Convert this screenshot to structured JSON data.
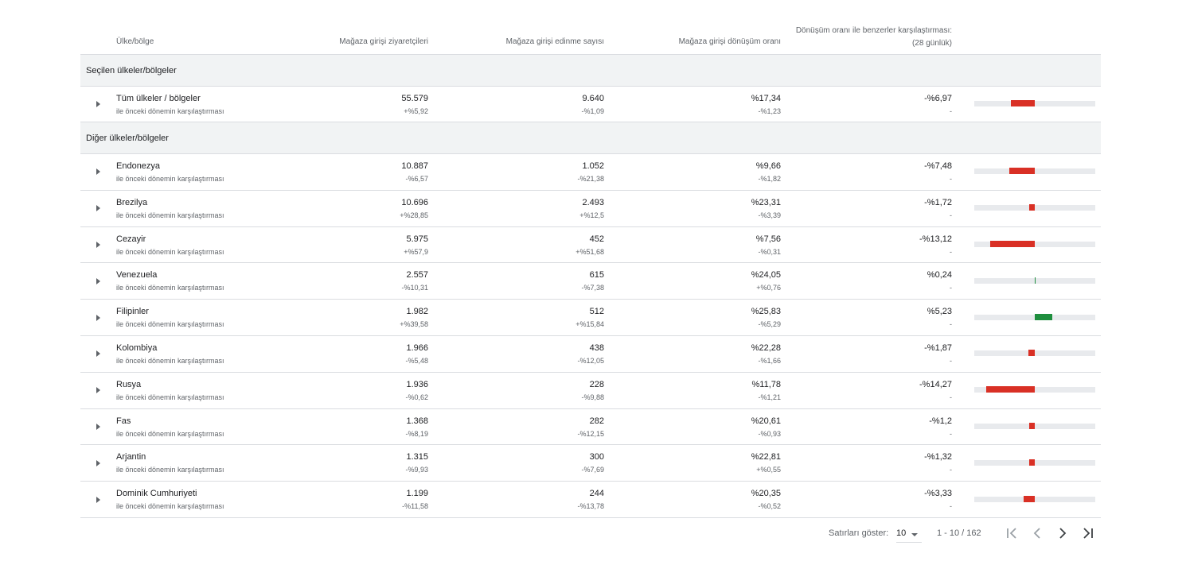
{
  "header": {
    "country": "Ülke/bölge",
    "visitors": "Mağaza girişi ziyaretçileri",
    "acquisitions": "Mağaza girişi edinme sayısı",
    "conversion": "Mağaza girişi dönüşüm oranı",
    "benchmark_line1": "Dönüşüm oranı ile benzerler karşılaştırması:",
    "benchmark_line2": "(28 günlük)"
  },
  "sections": {
    "selected": "Seçilen ülkeler/bölgeler",
    "other": "Diğer ülkeler/bölgeler"
  },
  "comparison_label": "ile önceki dönemin karşılaştırması",
  "all_row": {
    "name": "Tüm ülkeler / bölgeler",
    "visitors": "55.579",
    "visitors_change": "+%5,92",
    "acquisitions": "9.640",
    "acquisitions_change": "-%1,09",
    "conversion": "%17,34",
    "conversion_change": "-%1,23",
    "benchmark": "-%6,97",
    "benchmark_sub": "-",
    "benchmark_value": -6.97
  },
  "rows": [
    {
      "name": "Endonezya",
      "visitors": "10.887",
      "visitors_change": "-%6,57",
      "acquisitions": "1.052",
      "acquisitions_change": "-%21,38",
      "conversion": "%9,66",
      "conversion_change": "-%1,82",
      "benchmark": "-%7,48",
      "benchmark_sub": "-",
      "benchmark_value": -7.48
    },
    {
      "name": "Brezilya",
      "visitors": "10.696",
      "visitors_change": "+%28,85",
      "acquisitions": "2.493",
      "acquisitions_change": "+%12,5",
      "conversion": "%23,31",
      "conversion_change": "-%3,39",
      "benchmark": "-%1,72",
      "benchmark_sub": "-",
      "benchmark_value": -1.72
    },
    {
      "name": "Cezayir",
      "visitors": "5.975",
      "visitors_change": "+%57,9",
      "acquisitions": "452",
      "acquisitions_change": "+%51,68",
      "conversion": "%7,56",
      "conversion_change": "-%0,31",
      "benchmark": "-%13,12",
      "benchmark_sub": "-",
      "benchmark_value": -13.12
    },
    {
      "name": "Venezuela",
      "visitors": "2.557",
      "visitors_change": "-%10,31",
      "acquisitions": "615",
      "acquisitions_change": "-%7,38",
      "conversion": "%24,05",
      "conversion_change": "+%0,76",
      "benchmark": "%0,24",
      "benchmark_sub": "-",
      "benchmark_value": 0.24
    },
    {
      "name": "Filipinler",
      "visitors": "1.982",
      "visitors_change": "+%39,58",
      "acquisitions": "512",
      "acquisitions_change": "+%15,84",
      "conversion": "%25,83",
      "conversion_change": "-%5,29",
      "benchmark": "%5,23",
      "benchmark_sub": "-",
      "benchmark_value": 5.23
    },
    {
      "name": "Kolombiya",
      "visitors": "1.966",
      "visitors_change": "-%5,48",
      "acquisitions": "438",
      "acquisitions_change": "-%12,05",
      "conversion": "%22,28",
      "conversion_change": "-%1,66",
      "benchmark": "-%1,87",
      "benchmark_sub": "-",
      "benchmark_value": -1.87
    },
    {
      "name": "Rusya",
      "visitors": "1.936",
      "visitors_change": "-%0,62",
      "acquisitions": "228",
      "acquisitions_change": "-%9,88",
      "conversion": "%11,78",
      "conversion_change": "-%1,21",
      "benchmark": "-%14,27",
      "benchmark_sub": "-",
      "benchmark_value": -14.27
    },
    {
      "name": "Fas",
      "visitors": "1.368",
      "visitors_change": "-%8,19",
      "acquisitions": "282",
      "acquisitions_change": "-%12,15",
      "conversion": "%20,61",
      "conversion_change": "-%0,93",
      "benchmark": "-%1,2",
      "benchmark_sub": "-",
      "benchmark_value": -1.2
    },
    {
      "name": "Arjantin",
      "visitors": "1.315",
      "visitors_change": "-%9,93",
      "acquisitions": "300",
      "acquisitions_change": "-%7,69",
      "conversion": "%22,81",
      "conversion_change": "+%0,55",
      "benchmark": "-%1,32",
      "benchmark_sub": "-",
      "benchmark_value": -1.32
    },
    {
      "name": "Dominik Cumhuriyeti",
      "visitors": "1.199",
      "visitors_change": "-%11,58",
      "acquisitions": "244",
      "acquisitions_change": "-%13,78",
      "conversion": "%20,35",
      "conversion_change": "-%0,52",
      "benchmark": "-%3,33",
      "benchmark_sub": "-",
      "benchmark_value": -3.33
    }
  ],
  "footer": {
    "rows_label": "Satırları göster:",
    "rows_value": "10",
    "range": "1 - 10 / 162"
  },
  "colors": {
    "negative": "#d93025",
    "positive": "#1e8e3e",
    "track": "#e8eaed"
  }
}
